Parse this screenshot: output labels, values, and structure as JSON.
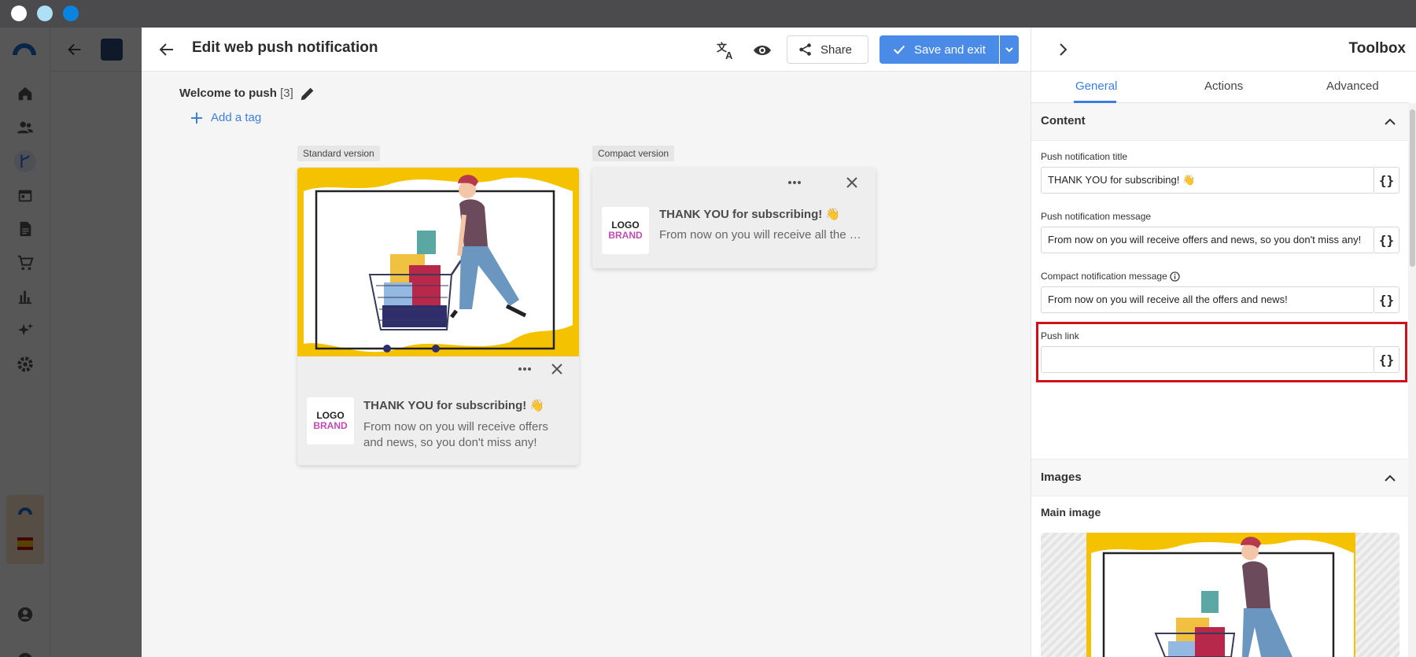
{
  "window": {
    "dots": [
      "#ffffff",
      "#aee0f5",
      "#0a84e0"
    ]
  },
  "editor": {
    "title": "Edit web push notification",
    "share_label": "Share",
    "save_label": "Save and exit",
    "campaign_name": "Welcome to push",
    "campaign_count": "[3]",
    "add_tag_label": "Add a tag",
    "standard_label": "Standard version",
    "compact_label": "Compact version"
  },
  "preview": {
    "logo_line1": "LOGO",
    "logo_line2": "BRAND",
    "title": "THANK YOU for subscribing! 👋",
    "message_standard": "From now on you will receive offers and news, so you don't miss any!",
    "message_compact": "From now on you will receive all the …"
  },
  "toolbox": {
    "title": "Toolbox",
    "tabs": [
      {
        "label": "General",
        "active": true
      },
      {
        "label": "Actions",
        "active": false
      },
      {
        "label": "Advanced",
        "active": false
      }
    ],
    "content_section": "Content",
    "fields": [
      {
        "label": "Push notification title",
        "value": "THANK YOU for subscribing! 👋"
      },
      {
        "label": "Push notification message",
        "value": "From now on you will receive offers and news, so you don't miss any!"
      },
      {
        "label": "Compact notification message",
        "value": "From now on you will receive all the offers and news!"
      },
      {
        "label": "Push link",
        "value": ""
      }
    ],
    "variable_button": "{}",
    "images_section": "Images",
    "main_image_label": "Main image"
  },
  "colors": {
    "accent": "#4a8be8",
    "highlight": "#d0111b",
    "brand_yellow": "#f5c200"
  }
}
